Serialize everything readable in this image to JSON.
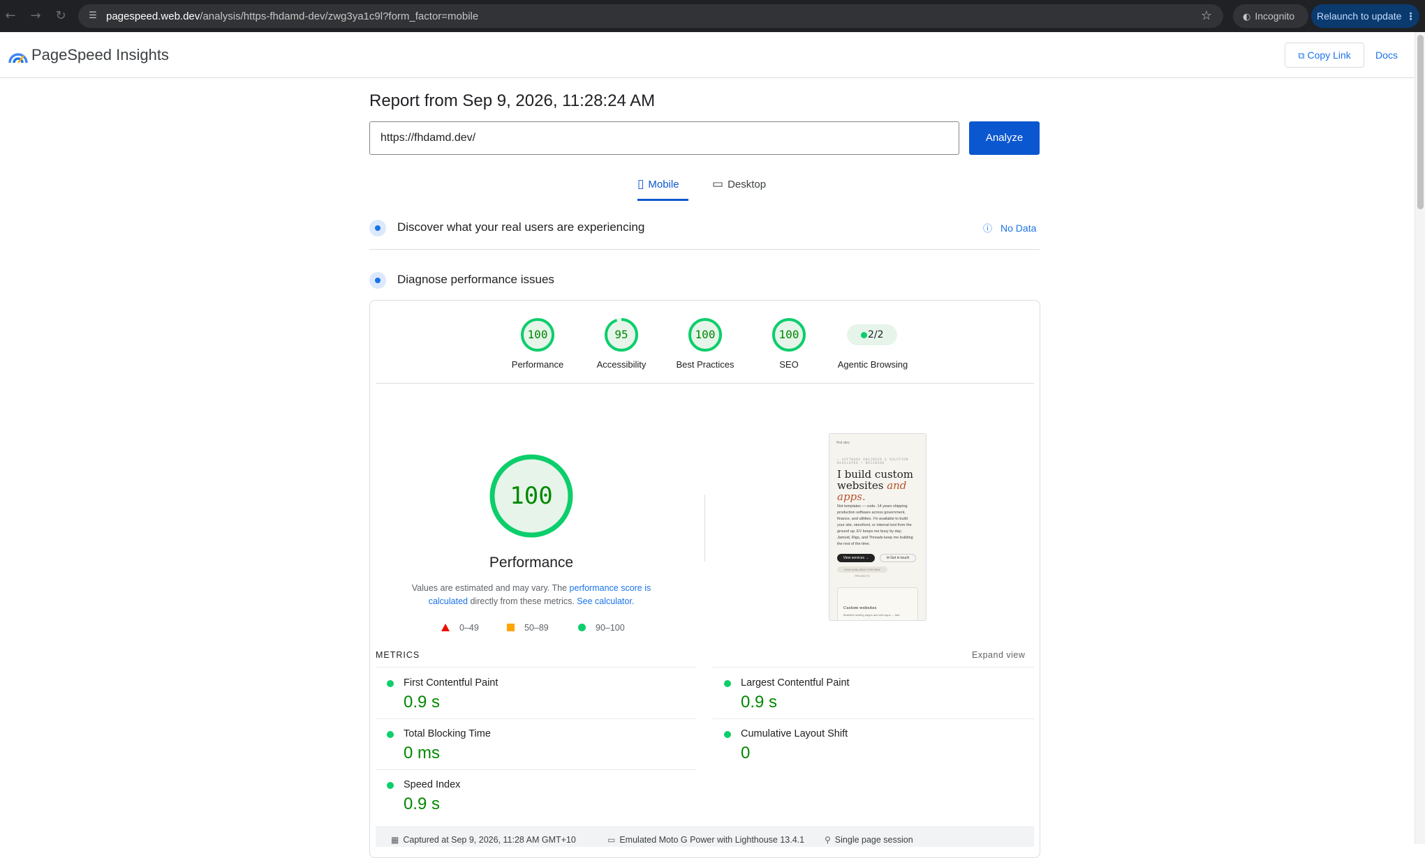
{
  "browser": {
    "url_host": "pagespeed.web.dev",
    "url_path": "/analysis/https-fhdamd-dev/zwg3ya1c9l?form_factor=mobile",
    "incognito_label": "Incognito",
    "relaunch_label": "Relaunch to update"
  },
  "header": {
    "brand": "PageSpeed Insights",
    "copy_link": "Copy Link",
    "docs": "Docs"
  },
  "report": {
    "title": "Report from Sep 9, 2026, 11:28:24 AM",
    "url_value": "https://fhdamd.dev/",
    "analyze_label": "Analyze"
  },
  "tabs": {
    "mobile": "Mobile",
    "desktop": "Desktop"
  },
  "sections": {
    "real_users": "Discover what your real users are experiencing",
    "no_data": "No Data",
    "diagnose": "Diagnose performance issues"
  },
  "scores": [
    {
      "label": "Performance",
      "value": "100",
      "fraction": 1.0
    },
    {
      "label": "Accessibility",
      "value": "95",
      "fraction": 0.95
    },
    {
      "label": "Best Practices",
      "value": "100",
      "fraction": 1.0
    },
    {
      "label": "SEO",
      "value": "100",
      "fraction": 1.0
    }
  ],
  "agentic": {
    "label": "Agentic Browsing",
    "value": "2/2"
  },
  "performance": {
    "score": "100",
    "title": "Performance",
    "desc_1": "Values are estimated and may vary. The ",
    "desc_link_1": "performance score is calculated",
    "desc_2": " directly from these metrics. ",
    "desc_link_2": "See calculator.",
    "legend": {
      "fail": "0–49",
      "average": "50–89",
      "pass": "90–100"
    }
  },
  "screenshot": {
    "logo_text": "fhd.dev",
    "tag": "— SOFTWARE ENGINEER & SOLUTION DEVELOPER • BRISBANE",
    "headline_1": "I build custom websites ",
    "headline_em_1": "and",
    "headline_em_2": "apps.",
    "paragraph": "Not templates — code. 14 years shipping production software across government, finance, and utilities. I'm available to build your site, storefront, or internal tool from the ground up. EV keeps me busy by day; Jamoid, Rigs, and Threads keep me building the rest of the time.",
    "button_primary": "View services →",
    "button_secondary": "✉ Get in touch",
    "note": "NOW AVAILABLE FOR NEW PROJECTS",
    "card_title": "Custom websites",
    "card_sub": "Beautiful landing pages and web apps — fast."
  },
  "metrics": {
    "heading": "METRICS",
    "expand": "Expand view",
    "items": [
      {
        "name": "First Contentful Paint",
        "value": "0.9 s"
      },
      {
        "name": "Largest Contentful Paint",
        "value": "0.9 s"
      },
      {
        "name": "Total Blocking Time",
        "value": "0 ms"
      },
      {
        "name": "Cumulative Layout Shift",
        "value": "0"
      },
      {
        "name": "Speed Index",
        "value": "0.9 s"
      }
    ]
  },
  "footer": {
    "captured": "Captured at Sep 9, 2026, 11:28 AM GMT+10",
    "emulated": "Emulated Moto G Power with Lighthouse 13.4.1",
    "session": "Single page session"
  },
  "colors": {
    "pass": "#0cce6b",
    "pass_text": "#008800",
    "average": "#ffa400",
    "fail": "#eb0f00",
    "primary": "#0b57d0"
  }
}
